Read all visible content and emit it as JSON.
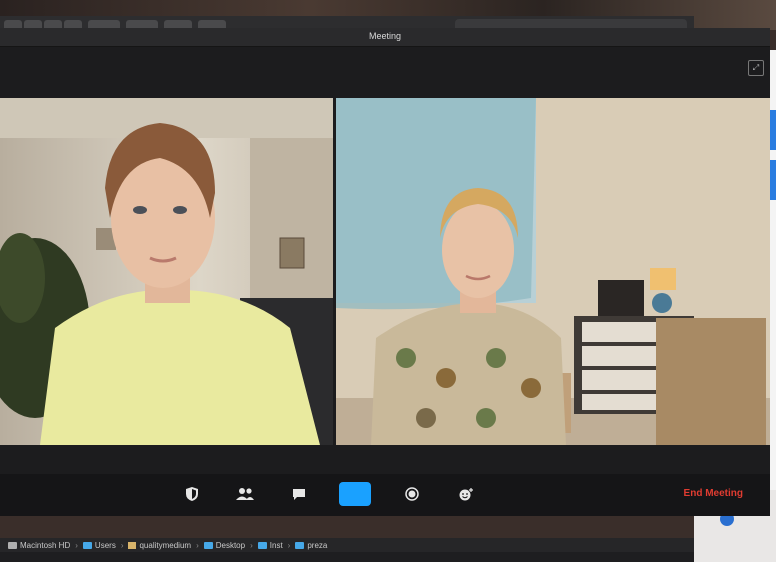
{
  "window": {
    "title": "Meeting"
  },
  "toolbar": {
    "security_icon": "shield-icon",
    "participants_icon": "participants-icon",
    "chat_icon": "chat-icon",
    "share_icon": "share-screen-icon",
    "record_icon": "record-icon",
    "reactions_icon": "reactions-icon",
    "end_label": "End Meeting"
  },
  "pathbar": {
    "segments": [
      "Macintosh HD",
      "Users",
      "qualitymedium",
      "Desktop",
      "Inst",
      "preza"
    ]
  },
  "colors": {
    "accent": "#1aa1ff",
    "end": "#e03c31"
  }
}
